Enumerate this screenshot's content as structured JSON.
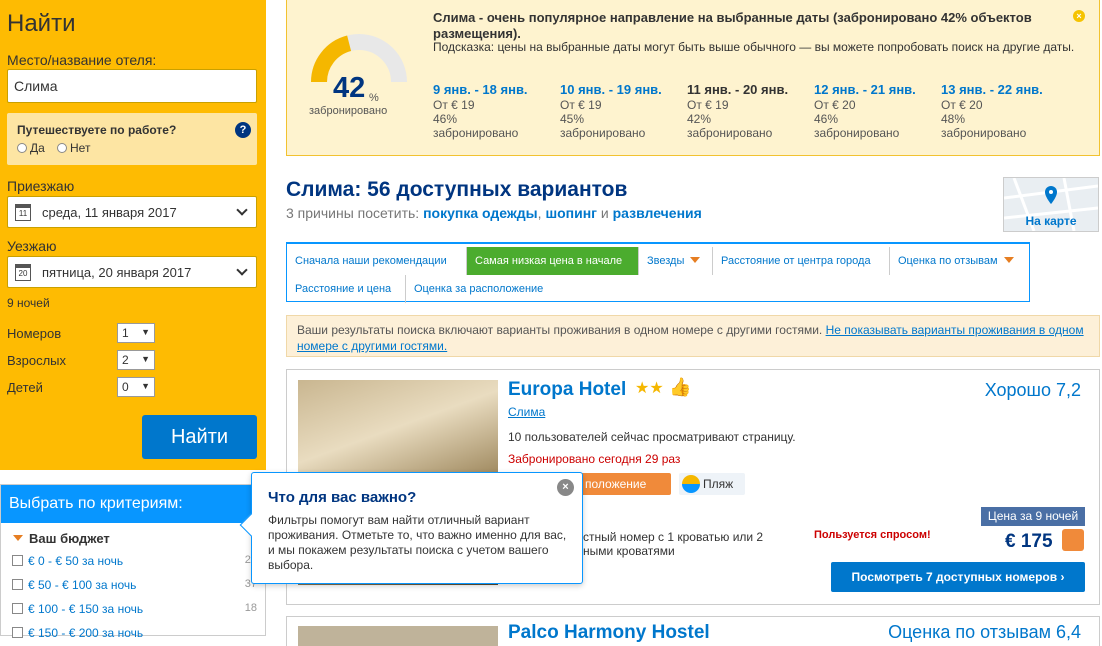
{
  "sidebar": {
    "title": "Найти",
    "dest_label": "Место/название отеля:",
    "dest_value": "Слима",
    "trip_question": "Путешествуете по работе?",
    "help_glyph": "?",
    "opt_yes": "Да",
    "opt_no": "Нет",
    "checkin_label": "Приезжаю",
    "checkin_day": "11",
    "checkin_value": "среда, 11 января 2017",
    "checkout_label": "Уезжаю",
    "checkout_day": "20",
    "checkout_value": "пятница, 20 января 2017",
    "nights": "9 ночей",
    "rooms_label": "Номеров",
    "rooms_value": "1",
    "adults_label": "Взрослых",
    "adults_value": "2",
    "children_label": "Детей",
    "children_value": "0",
    "search_button": "Найти"
  },
  "filter": {
    "header": "Выбрать по критериям:",
    "budget_title": "Ваш бюджет",
    "budget": [
      {
        "label": "€ 0 - € 50 за ночь",
        "count": "20"
      },
      {
        "label": "€ 50 - € 100 за ночь",
        "count": "37"
      },
      {
        "label": "€ 100 - € 150 за ночь",
        "count": "18"
      },
      {
        "label": "€ 150 - € 200 за ночь",
        "count": ""
      }
    ]
  },
  "notice": {
    "percent": "42",
    "percent_sign": "%",
    "percent_value": 0.42,
    "booked_label": "забронировано",
    "title": "Слима - очень популярное направление на выбранные даты (забронировано 42% объектов размещения).",
    "tip": "Подсказка: цены на выбранные даты могут быть выше обычного — вы можете попробовать поиск на другие даты.",
    "close_glyph": "×",
    "dates": [
      {
        "range": "9 янв. - 18 янв.",
        "price": "От € 19",
        "pct": "46%",
        "label": "забронировано"
      },
      {
        "range": "10 янв. - 19 янв.",
        "price": "От € 19",
        "pct": "45%",
        "label": "забронировано"
      },
      {
        "range": "11 янв. - 20 янв.",
        "price": "От € 19",
        "pct": "42%",
        "label": "забронировано"
      },
      {
        "range": "12 янв. - 21 янв.",
        "price": "От € 20",
        "pct": "46%",
        "label": "забронировано"
      },
      {
        "range": "13 янв. - 22 янв.",
        "price": "От € 20",
        "pct": "48%",
        "label": "забронировано"
      }
    ]
  },
  "results": {
    "title": "Слима: 56 доступных вариантов",
    "reasons_prefix": "3 причины посетить: ",
    "reason1": "покупка одежды",
    "reason_sep": ", ",
    "reason2": "шопинг",
    "reason_and": " и ",
    "reason3": "развлечения",
    "map_label": "На карте"
  },
  "sort_tabs": [
    "Сначала наши рекомендации",
    "Самая низкая цена в начале",
    "Звезды",
    "Расстояние от центра города",
    "Оценка по отзывам",
    "Расстояние и цена",
    "Оценка за расположение"
  ],
  "shared_notice": {
    "text": "Ваши результаты поиска включают варианты проживания в одном номере с другими гостями. ",
    "link": "Не показывать варианты проживания в одном номере с другими гостями."
  },
  "hotel": {
    "name": "Europa Hotel",
    "stars": "★★",
    "thumb_glyph": "👍",
    "city": "Слима",
    "viewers": "10 пользователей сейчас просматривают страницу.",
    "booked": "Забронировано сегодня 29 раз",
    "location_badge": "положение",
    "beach": "Пляж",
    "room_desc": "стный номер с 1 кроватью или 2 ными кроватями",
    "rating": "Хорошо 7,2",
    "demand": "Пользуется спросом!",
    "price_label": "Цена за 9 ночей",
    "price": "€ 175",
    "view_button": "Посмотреть 7 доступных номеров  ›"
  },
  "hotel2": {
    "name": "Palco Harmony Hostel",
    "rating": "Оценка по отзывам 6,4"
  },
  "popup": {
    "title": "Что для вас важно?",
    "text": "Фильтры помогут вам найти отличный вариант проживания. Отметьте то, что важно именно для вас, и мы покажем результаты поиска с учетом вашего выбора.",
    "close_glyph": "×"
  }
}
